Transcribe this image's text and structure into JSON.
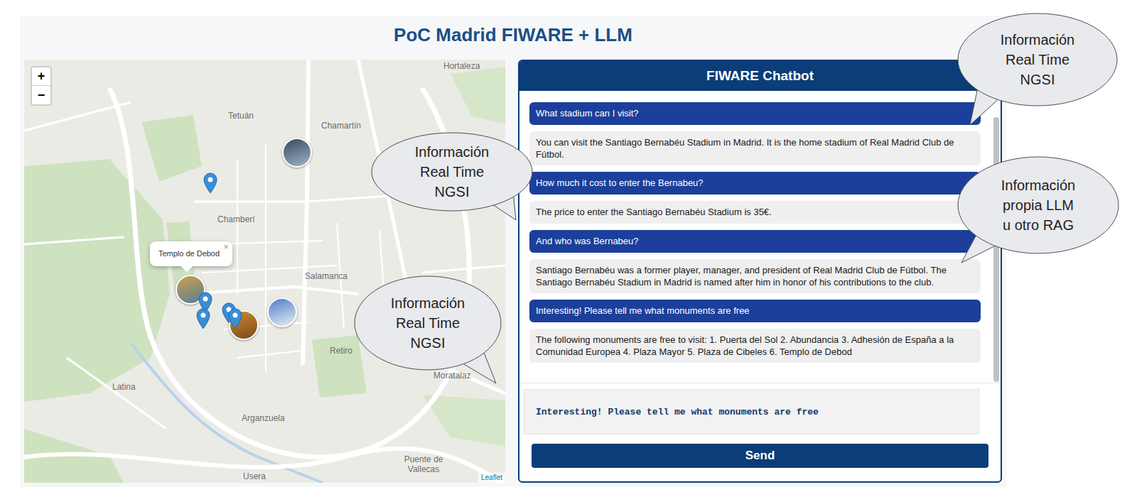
{
  "page": {
    "title": "PoC Madrid FIWARE + LLM"
  },
  "map": {
    "zoom_in": "+",
    "zoom_out": "−",
    "attribution": "Leaflet",
    "labels": [
      "Hortaleza",
      "Tetuán",
      "Chamartín",
      "Chamberí",
      "Salamanca",
      "Retiro",
      "Moratalaz",
      "Latina",
      "Arganzuela",
      "Puente de Vallecas",
      "Usera"
    ],
    "popup": {
      "text": "Templo de Debod",
      "close": "×"
    },
    "markers": [
      {
        "kind": "pin"
      },
      {
        "kind": "pin"
      },
      {
        "kind": "pin"
      },
      {
        "kind": "pin"
      },
      {
        "kind": "pin"
      },
      {
        "kind": "photo"
      },
      {
        "kind": "photo"
      },
      {
        "kind": "photo"
      },
      {
        "kind": "photo"
      }
    ]
  },
  "chat": {
    "title": "FIWARE Chatbot",
    "messages": [
      {
        "kind": "user",
        "text": "What stadium can I visit?"
      },
      {
        "kind": "bot",
        "text": "You can visit the Santiago Bernabéu Stadium in Madrid. It is the home stadium of Real Madrid Club de Fútbol."
      },
      {
        "kind": "user",
        "text": "How much it cost to enter the Bernabeu?"
      },
      {
        "kind": "bot",
        "text": "The price to enter the Santiago Bernabéu Stadium is 35€."
      },
      {
        "kind": "user",
        "text": "And who was Bernabeu?"
      },
      {
        "kind": "bot",
        "text": "Santiago Bernabéu was a former player, manager, and president of Real Madrid Club de Fútbol. The Santiago Bernabéu Stadium in Madrid is named after him in honor of his contributions to the club."
      },
      {
        "kind": "user",
        "text": "Interesting! Please tell me what monuments are free"
      },
      {
        "kind": "bot",
        "text": "The following monuments are free to visit: 1. Puerta del Sol 2. Abundancia 3. Adhesión de España a la Comunidad Europea 4. Plaza Mayor 5. Plaza de Cibeles 6. Templo de Debod"
      }
    ],
    "input": {
      "value": "Interesting! Please tell me what monuments are free"
    },
    "send": "Send"
  },
  "callouts": [
    {
      "lines": [
        "Información",
        "Real Time",
        "NGSI"
      ]
    },
    {
      "lines": [
        "Información",
        "propia LLM",
        "u otro RAG"
      ]
    },
    {
      "lines": [
        "Información",
        "Real Time",
        "NGSI"
      ]
    },
    {
      "lines": [
        "Información",
        "Real Time",
        "NGSI"
      ]
    }
  ]
}
